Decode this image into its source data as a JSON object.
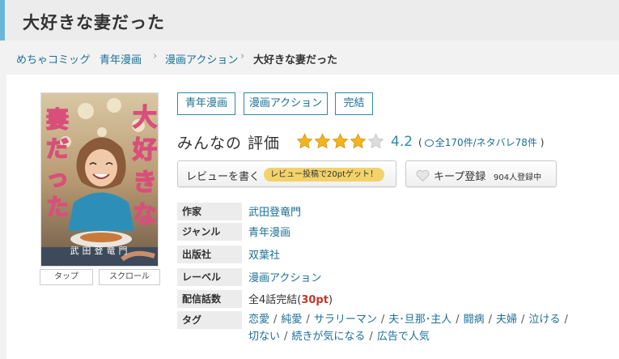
{
  "page": {
    "title": "大好きな妻だった"
  },
  "breadcrumb": [
    "めちゃコミック",
    "青年漫画",
    "漫画アクション",
    "大好きな妻だった"
  ],
  "cover": {
    "title_art": "大好きな妻だった",
    "author_art": "武田登竜門",
    "tap_label": "タップ",
    "scroll_label": "スクロール"
  },
  "genre_tags": [
    "青年漫画",
    "漫画アクション",
    "完結"
  ],
  "rating": {
    "label": "みんなの 評価",
    "score": "4.2",
    "stars_filled": 4,
    "stars_total": 5,
    "open_paren": "(",
    "count_text": "全170件/ネタバレ78件",
    "close_paren": ")"
  },
  "actions": {
    "review_label": "レビューを書く",
    "review_promo": "レビュー投稿で20ptゲット！",
    "keep_label": "キープ登録",
    "keep_count": "904人登録中"
  },
  "info": {
    "author_key": "作家",
    "author": "武田登竜門",
    "genre_key": "ジャンル",
    "genre": "青年漫画",
    "publisher_key": "出版社",
    "publisher": "双葉社",
    "label_key": "レーベル",
    "label": "漫画アクション",
    "episodes_key": "配信話数",
    "episodes_prefix": "全4話完結(",
    "episodes_pt": "30pt",
    "episodes_suffix": ")",
    "tags_key": "タグ",
    "tags": [
      "恋愛",
      "純愛",
      "サラリーマン",
      "夫･旦那･主人",
      "闘病",
      "夫婦",
      "泣ける",
      "切ない",
      "続きが気になる",
      "広告で人気"
    ]
  },
  "colors": {
    "accent": "#6bb6d6",
    "link": "#1a6f95",
    "star": "#f3b51b",
    "promo": "#f2d26a",
    "point": "#c0392b"
  }
}
